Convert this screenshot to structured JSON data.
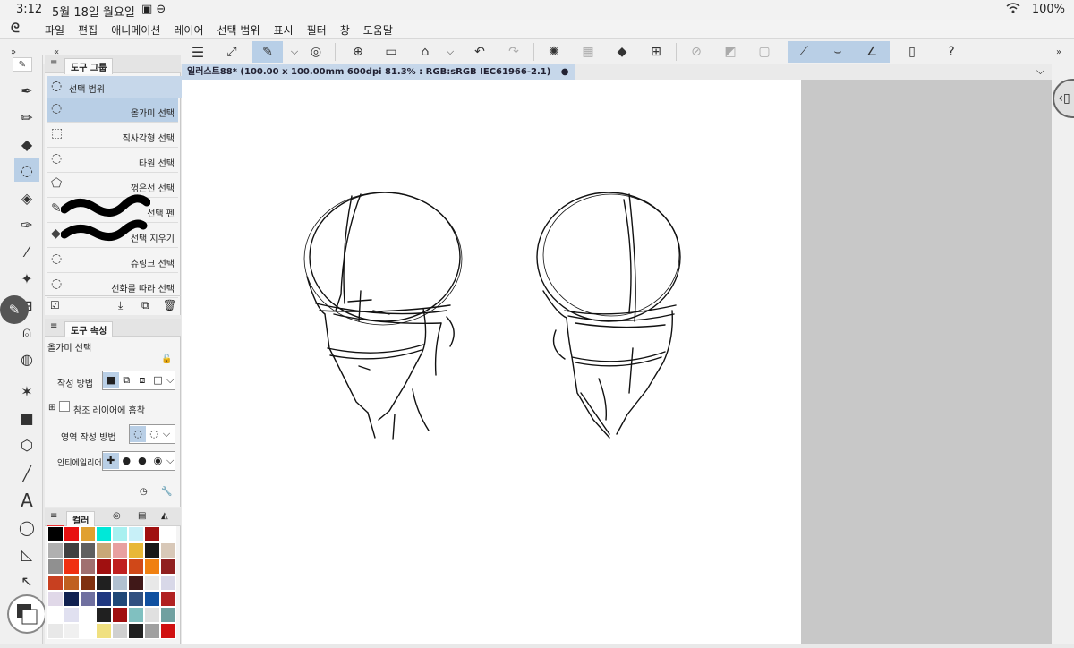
{
  "status": {
    "time": "3:12",
    "date": "5월 18일 월요일",
    "battery": "100%"
  },
  "menu": [
    "파일",
    "편집",
    "애니메이션",
    "레이어",
    "선택 범위",
    "표시",
    "필터",
    "창",
    "도움말"
  ],
  "document": {
    "tab_title": "일러스트88* (100.00 x 100.00mm 600dpi 81.3% : RGB:sRGB IEC61966-2.1)",
    "modified_dot": "●"
  },
  "tool_group": {
    "panel_tab": "도구 그룹",
    "group_label": "선택 범위",
    "items": [
      {
        "label": "올가미 선택",
        "icon": "lasso-icon",
        "selected": true
      },
      {
        "label": "직사각형 선택",
        "icon": "rect-select-icon"
      },
      {
        "label": "타원 선택",
        "icon": "ellipse-select-icon"
      },
      {
        "label": "꺾은선 선택",
        "icon": "polyline-select-icon"
      },
      {
        "label": "선택 펜",
        "icon": "selection-pen-icon"
      },
      {
        "label": "선택 지우기",
        "icon": "selection-eraser-icon"
      },
      {
        "label": "슈링크 선택",
        "icon": "shrink-select-icon"
      },
      {
        "label": "선화를 따라 선택",
        "icon": "trace-select-icon"
      }
    ]
  },
  "tool_property": {
    "panel_tab": "도구 속성",
    "subtool_name": "올가미 선택",
    "creation_method_label": "작성 방법",
    "snap_label": "참조 레이어에 흡착",
    "area_method_label": "영역 작성 방법",
    "antialias_label": "안티에일리어싱"
  },
  "color_panel": {
    "tab_label": "컬러",
    "swatches": [
      "#000000",
      "#e81010",
      "#e0a030",
      "#00e8d8",
      "#a8f0f0",
      "#c8f0f8",
      "#a01010",
      "#ffffff",
      "#b0b0b0",
      "#404040",
      "#606060",
      "#c8a878",
      "#e8a0a0",
      "#e8b838",
      "#181818",
      "#d8c8b8",
      "#909090",
      "#f03010",
      "#a07070",
      "#a01010",
      "#c02020",
      "#d04818",
      "#f08010",
      "#902020",
      "#c84020",
      "#c06020",
      "#803010",
      "#202020",
      "#b0c0d0",
      "#401818",
      "#e8e8e8",
      "#d8d8e8",
      "#e0d8e8",
      "#102050",
      "#7070a0",
      "#203880",
      "#204878",
      "#305080",
      "#1050a0",
      "#b02020",
      "#ffffff",
      "#e0e0f0",
      "#ffffff",
      "#202020",
      "#a01010",
      "#80c0c0",
      "#e0e0e0",
      "#70a0a0",
      "#e8e8e8",
      "#f0f0f0",
      "#ffffff",
      "#f0e080",
      "#d0d0d0",
      "#202020",
      "#a0a0a0",
      "#d01010"
    ]
  },
  "colors": {
    "selected_bg": "#b9cfe6",
    "tab_bg": "#c6d7ea"
  }
}
